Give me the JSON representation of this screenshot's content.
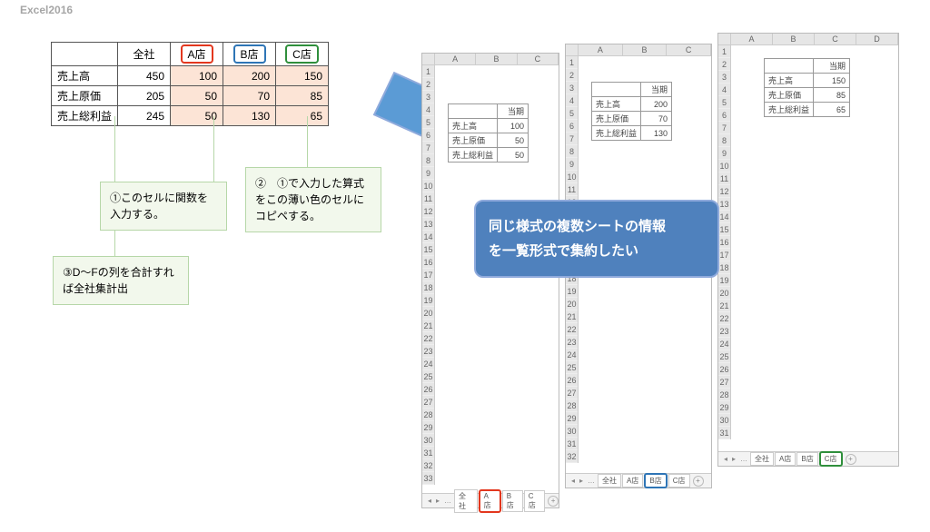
{
  "app_title": "Excel2016",
  "summary": {
    "headers": {
      "blank": "",
      "all": "全社",
      "a": "A店",
      "b": "B店",
      "c": "C店"
    },
    "rows": {
      "sales": {
        "label": "売上高",
        "all": "450",
        "a": "100",
        "b": "200",
        "c": "150"
      },
      "cogs": {
        "label": "売上原価",
        "all": "205",
        "a": "50",
        "b": "70",
        "c": "85"
      },
      "gross": {
        "label": "売上総利益",
        "all": "245",
        "a": "50",
        "b": "130",
        "c": "65"
      }
    }
  },
  "annotations": {
    "note1": "①このセルに関数を入力する。",
    "note2": "②　①で入力した算式をこの薄い色のセルにコピペする。",
    "note3": "③D～Fの列を合計すれば全社集計出"
  },
  "callout": {
    "line1": "同じ様式の複数シートの情報",
    "line2": "を一覧形式で集約したい"
  },
  "mini_common": {
    "cols3": {
      "A": "A",
      "B": "B",
      "C": "C"
    },
    "cols4": {
      "A": "A",
      "B": "B",
      "C": "C",
      "D": "D"
    },
    "period": "当期",
    "sales": "売上高",
    "cogs": "売上原価",
    "gross": "売上総利益",
    "tabs": {
      "all": "全社",
      "a": "A店",
      "b": "B店",
      "c": "C店"
    },
    "nav": "…",
    "plus": "+"
  },
  "miniA": {
    "sales": "100",
    "cogs": "50",
    "gross": "50"
  },
  "miniB": {
    "sales": "200",
    "cogs": "70",
    "gross": "130"
  },
  "miniC": {
    "sales": "150",
    "cogs": "85",
    "gross": "65"
  }
}
